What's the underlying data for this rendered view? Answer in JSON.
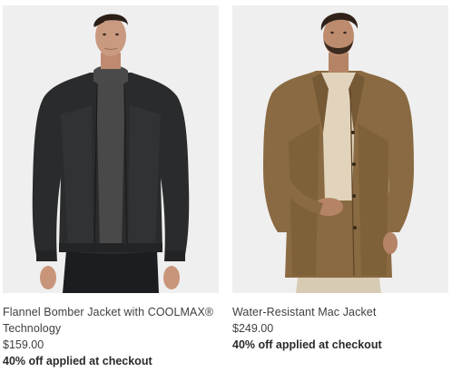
{
  "products": [
    {
      "name": "Flannel Bomber Jacket with COOLMAX® Technology",
      "price": "$159.00",
      "promo": "40% off applied at checkout",
      "image_alt": "model wearing black flannel bomber jacket",
      "jacket_color": "#2a2b2c"
    },
    {
      "name": "Water-Resistant Mac Jacket",
      "price": "$249.00",
      "promo": "40% off applied at checkout",
      "image_alt": "model wearing olive brown mac jacket",
      "jacket_color": "#8a6a42"
    }
  ]
}
